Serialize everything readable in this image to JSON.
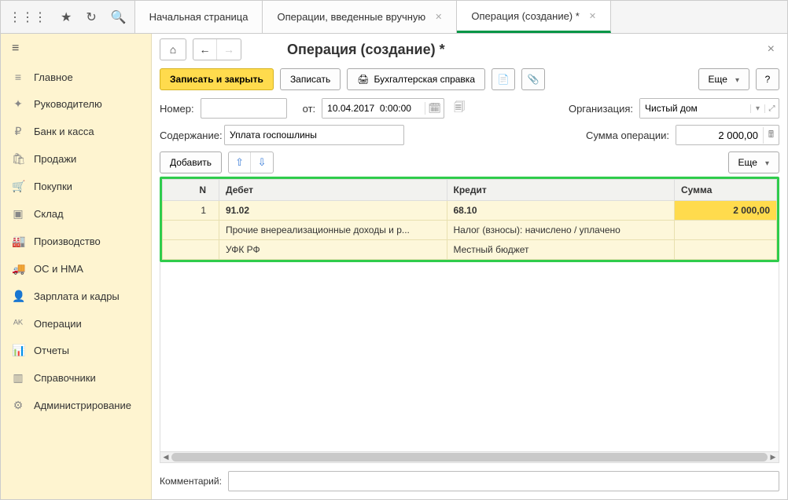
{
  "topbar": {
    "tabs": [
      {
        "label": "Начальная страница",
        "closable": false,
        "active": false
      },
      {
        "label": "Операции, введенные вручную",
        "closable": true,
        "active": false
      },
      {
        "label": "Операция (создание) *",
        "closable": true,
        "active": true
      }
    ]
  },
  "sidebar": {
    "items": [
      {
        "icon": "≡",
        "label": "Главное"
      },
      {
        "icon": "✦",
        "label": "Руководителю"
      },
      {
        "icon": "₽",
        "label": "Банк и касса"
      },
      {
        "icon": "🛍",
        "label": "Продажи"
      },
      {
        "icon": "🛒",
        "label": "Покупки"
      },
      {
        "icon": "▣",
        "label": "Склад"
      },
      {
        "icon": "🏭",
        "label": "Производство"
      },
      {
        "icon": "🚚",
        "label": "ОС и НМА"
      },
      {
        "icon": "👤",
        "label": "Зарплата и кадры"
      },
      {
        "icon": "ᴬᴷ",
        "label": "Операции"
      },
      {
        "icon": "📊",
        "label": "Отчеты"
      },
      {
        "icon": "▥",
        "label": "Справочники"
      },
      {
        "icon": "⚙",
        "label": "Администрирование"
      }
    ]
  },
  "page": {
    "title": "Операция (создание) *"
  },
  "toolbar": {
    "save_close": "Записать и закрыть",
    "save": "Записать",
    "acc_ref": "Бухгалтерская справка",
    "more": "Еще",
    "help": "?"
  },
  "form": {
    "number_label": "Номер:",
    "number_value": "",
    "from_label": "от:",
    "date_value": "10.04.2017  0:00:00",
    "org_label": "Организация:",
    "org_value": "Чистый дом",
    "content_label": "Содержание:",
    "content_value": "Уплата госпошлины",
    "sum_label": "Сумма операции:",
    "sum_value": "2 000,00",
    "comment_label": "Комментарий:",
    "comment_value": ""
  },
  "subbar": {
    "add": "Добавить",
    "more": "Еще"
  },
  "table": {
    "headers": {
      "n": "N",
      "debit": "Дебет",
      "credit": "Кредит",
      "sum": "Сумма"
    },
    "rows": [
      {
        "n": "1",
        "debit_code": "91.02",
        "debit_line2": "Прочие внереализационные доходы и р...",
        "debit_line3": "УФК РФ",
        "credit_code": "68.10",
        "credit_line2": "Налог (взносы): начислено / уплачено",
        "credit_line3": "Местный бюджет",
        "sum": "2 000,00"
      }
    ]
  }
}
